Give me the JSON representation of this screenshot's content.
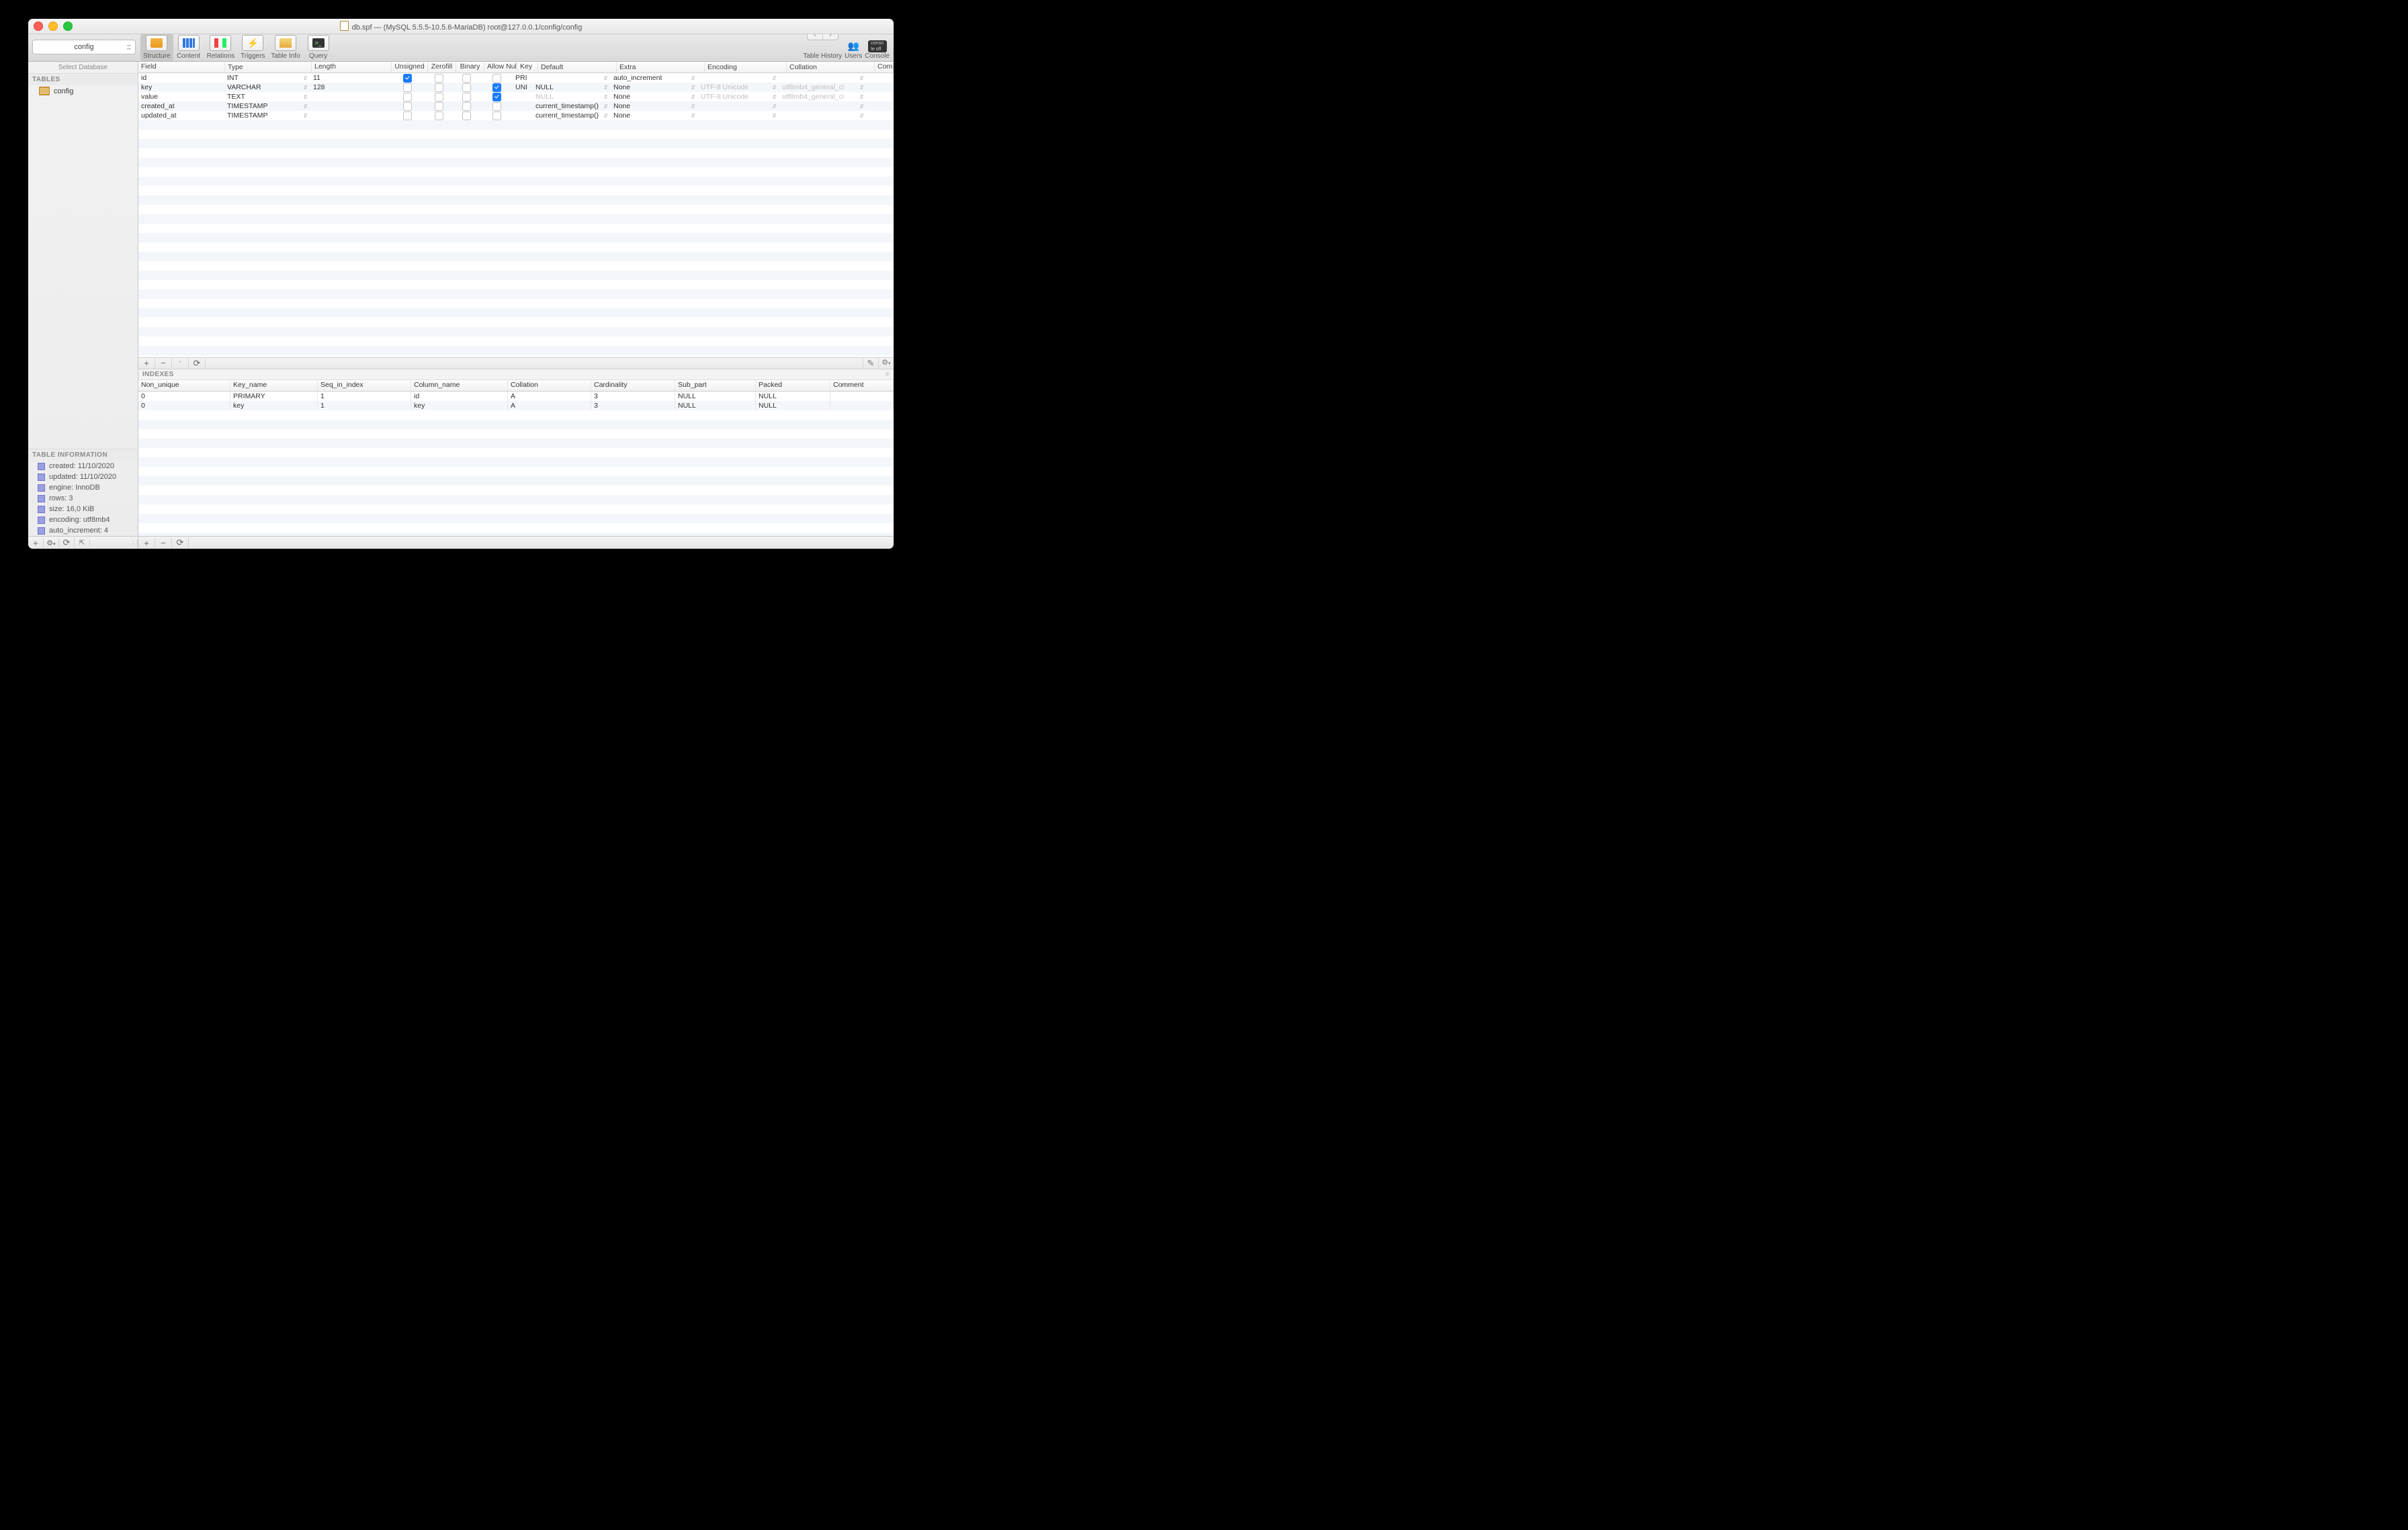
{
  "title": "db.spf — (MySQL 5.5.5-10.5.6-MariaDB) root@127.0.0.1/config/config",
  "db_selector": "config",
  "select_db_label": "Select Database",
  "toolbar": {
    "structure": "Structure",
    "content": "Content",
    "relations": "Relations",
    "triggers": "Triggers",
    "tableinfo": "Table Info",
    "query": "Query",
    "table_history": "Table History",
    "users": "Users",
    "console": "Console"
  },
  "sidebar": {
    "tables_header": "TABLES",
    "tables": [
      {
        "name": "config"
      }
    ],
    "info_header": "TABLE INFORMATION",
    "info": [
      {
        "label": "created: 11/10/2020"
      },
      {
        "label": "updated: 11/10/2020"
      },
      {
        "label": "engine: InnoDB"
      },
      {
        "label": "rows: 3"
      },
      {
        "label": "size: 16,0 KiB"
      },
      {
        "label": "encoding: utf8mb4"
      },
      {
        "label": "auto_increment: 4"
      }
    ]
  },
  "columns_headers": {
    "field": "Field",
    "type": "Type",
    "length": "Length",
    "unsigned": "Unsigned",
    "zerofill": "Zerofill",
    "binary": "Binary",
    "allownull": "Allow Null",
    "key": "Key",
    "default": "Default",
    "extra": "Extra",
    "encoding": "Encoding",
    "collation": "Collation",
    "comment": "Comment"
  },
  "columns": [
    {
      "field": "id",
      "type": "INT",
      "length": "11",
      "unsigned": true,
      "zerofill": false,
      "binary": false,
      "allownull": false,
      "key": "PRI",
      "default": "",
      "extra": "auto_increment",
      "encoding": "",
      "collation": ""
    },
    {
      "field": "key",
      "type": "VARCHAR",
      "length": "128",
      "unsigned": false,
      "zerofill": false,
      "binary": false,
      "allownull": true,
      "key": "UNI",
      "default": "NULL",
      "extra": "None",
      "encoding": "UTF-8 Unicode",
      "collation": "utf8mb4_general_ci"
    },
    {
      "field": "value",
      "type": "TEXT",
      "length": "",
      "unsigned": false,
      "zerofill": false,
      "binary": false,
      "allownull": true,
      "key": "",
      "default": "NULL",
      "default_dim": true,
      "extra": "None",
      "encoding": "UTF-8 Unicode",
      "collation": "utf8mb4_general_ci"
    },
    {
      "field": "created_at",
      "type": "TIMESTAMP",
      "length": "",
      "unsigned": false,
      "zerofill": false,
      "binary": false,
      "allownull": false,
      "key": "",
      "default": "current_timestamp()",
      "extra": "None",
      "encoding": "",
      "collation": ""
    },
    {
      "field": "updated_at",
      "type": "TIMESTAMP",
      "length": "",
      "unsigned": false,
      "zerofill": false,
      "binary": false,
      "allownull": false,
      "key": "",
      "default": "current_timestamp()",
      "extra": "None",
      "encoding": "",
      "collation": ""
    }
  ],
  "indexes_header": "INDEXES",
  "index_headers": {
    "non_unique": "Non_unique",
    "key_name": "Key_name",
    "seq": "Seq_in_index",
    "col": "Column_name",
    "coll": "Collation",
    "card": "Cardinality",
    "sub": "Sub_part",
    "packed": "Packed",
    "comment": "Comment"
  },
  "indexes": [
    {
      "non_unique": "0",
      "key_name": "PRIMARY",
      "seq": "1",
      "col": "id",
      "coll": "A",
      "card": "3",
      "sub": "NULL",
      "packed": "NULL",
      "comment": ""
    },
    {
      "non_unique": "0",
      "key_name": "key",
      "seq": "1",
      "col": "key",
      "coll": "A",
      "card": "3",
      "sub": "NULL",
      "packed": "NULL",
      "comment": ""
    }
  ]
}
